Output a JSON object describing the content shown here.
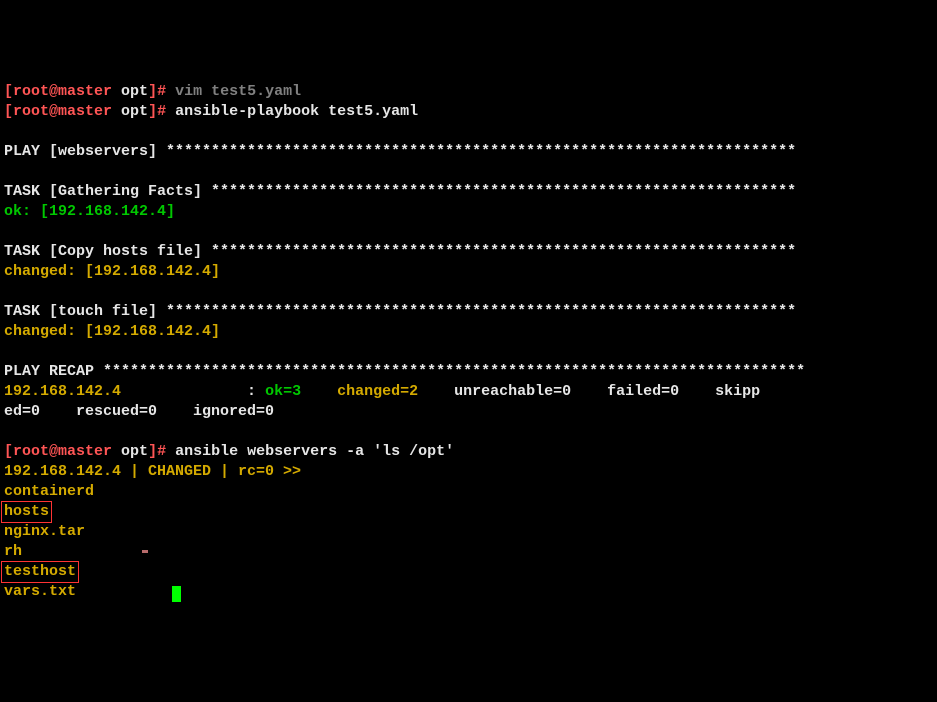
{
  "prompt1": {
    "bracket": "[",
    "user": "root@master",
    "path": " opt",
    "close": "]",
    "hash": "# ",
    "cmd": "vim test5.yaml"
  },
  "prompt2": {
    "bracket": "[",
    "user": "root@master",
    "path": " opt",
    "close": "]",
    "hash": "# ",
    "cmd": "ansible-playbook test5.yaml"
  },
  "play": {
    "label": "PLAY [webservers] ",
    "stars": "**********************************************************************"
  },
  "task1": {
    "label": "TASK [Gathering Facts] ",
    "stars": "*****************************************************************"
  },
  "task1_result": {
    "status": "ok: ",
    "host": "[192.168.142.4]"
  },
  "task2": {
    "label": "TASK [Copy hosts file] ",
    "stars": "*****************************************************************"
  },
  "task2_result": {
    "status": "changed: ",
    "host": "[192.168.142.4]"
  },
  "task3": {
    "label": "TASK [touch file] ",
    "stars": "**********************************************************************"
  },
  "task3_result": {
    "status": "changed: ",
    "host": "[192.168.142.4]"
  },
  "recap_header": {
    "label": "PLAY RECAP ",
    "stars": "******************************************************************************"
  },
  "recap": {
    "host": "192.168.142.4             ",
    "colon": " : ",
    "ok": "ok=3   ",
    "changed": " changed=2   ",
    "stats": " unreachable=0    failed=0    skipp",
    "line2": "ed=0    rescued=0    ignored=0"
  },
  "prompt3": {
    "bracket": "[",
    "user": "root@master",
    "path": " opt",
    "close": "]",
    "hash": "# ",
    "cmd": "ansible webservers -a 'ls /opt'"
  },
  "ls_header": "192.168.142.4 | CHANGED | rc=0 >>",
  "ls": {
    "f1": "containerd",
    "f2": "hosts",
    "f3": "nginx.tar",
    "f4": "rh",
    "f5": "testhost",
    "f6": "vars.txt"
  }
}
